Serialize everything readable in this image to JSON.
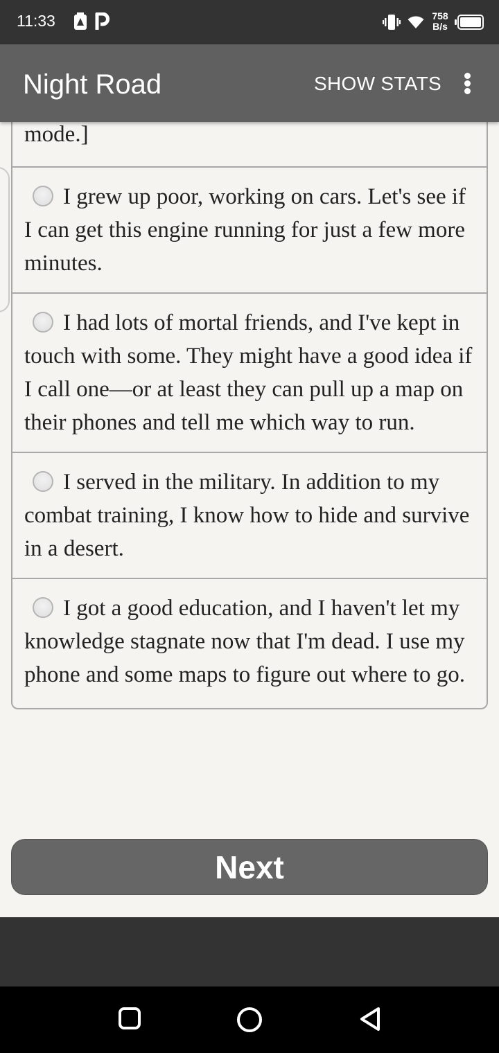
{
  "status_bar": {
    "time": "11:33",
    "net_speed_value": "758",
    "net_speed_unit": "B/s"
  },
  "app_bar": {
    "title": "Night Road",
    "show_stats_label": "SHOW STATS"
  },
  "choices": {
    "previous_fragment": "mode.]",
    "options": [
      "I grew up poor, working on cars. Let's see if I can get this engine running for just a few more minutes.",
      "I had lots of mortal friends, and I've kept in touch with some. They might have a good idea if I call one—or at least they can pull up a map on their phones and tell me which way to run.",
      "I served in the military. In addition to my combat training, I know how to hide and survive in a desert.",
      "I got a good education, and I haven't let my knowledge stagnate now that I'm dead. I use my phone and some maps to figure out where to go."
    ]
  },
  "next_label": "Next",
  "colors": {
    "status_bar": "#333333",
    "app_bar": "#606060",
    "content_bg": "#f6f4f1",
    "button": "#666666"
  },
  "icons": [
    "alert-icon",
    "parking-icon",
    "vibrate-icon",
    "wifi-icon",
    "battery-icon",
    "overflow-menu-icon",
    "recents-icon",
    "home-icon",
    "back-icon"
  ]
}
